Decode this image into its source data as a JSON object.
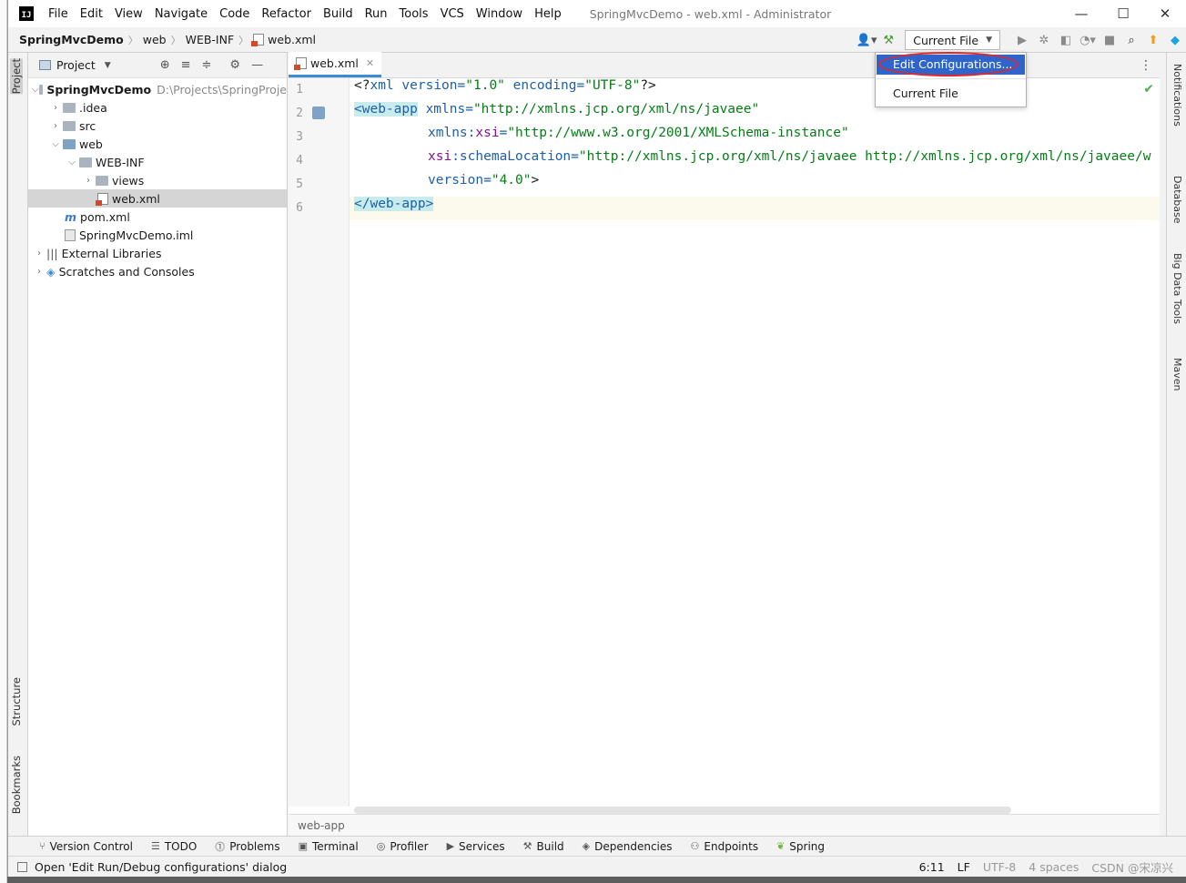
{
  "window": {
    "title": "SpringMvcDemo - web.xml - Administrator",
    "logo": "IJ",
    "controls": {
      "minimize": "—",
      "maximize": "☐",
      "close": "✕"
    }
  },
  "menu": [
    "File",
    "Edit",
    "View",
    "Navigate",
    "Code",
    "Refactor",
    "Build",
    "Run",
    "Tools",
    "VCS",
    "Window",
    "Help"
  ],
  "breadcrumb": [
    "SpringMvcDemo",
    "web",
    "WEB-INF",
    "web.xml"
  ],
  "toolbar": {
    "run_config": "Current File",
    "icons": [
      "user-icon",
      "hammer-icon",
      "run-icon",
      "debug-icon",
      "coverage-icon",
      "profile-icon",
      "stop-icon",
      "search-icon",
      "update-icon",
      "jetbrains-icon"
    ]
  },
  "run_config_menu": {
    "items": [
      "Edit Configurations...",
      "Current File"
    ],
    "highlighted": "Edit Configurations..."
  },
  "project_panel": {
    "title": "Project",
    "tree": [
      {
        "label": "SpringMvcDemo",
        "path": "D:\\Projects\\SpringProje",
        "depth": 0,
        "expanded": true,
        "bold": true
      },
      {
        "label": ".idea",
        "depth": 1,
        "expanded": false
      },
      {
        "label": "src",
        "depth": 1,
        "expanded": false
      },
      {
        "label": "web",
        "depth": 1,
        "expanded": true
      },
      {
        "label": "WEB-INF",
        "depth": 2,
        "expanded": true
      },
      {
        "label": "views",
        "depth": 3,
        "expanded": false
      },
      {
        "label": "web.xml",
        "depth": 3,
        "selected": true
      },
      {
        "label": "pom.xml",
        "depth": 1
      },
      {
        "label": "SpringMvcDemo.iml",
        "depth": 1
      },
      {
        "label": "External Libraries",
        "depth": 0,
        "expanded": false
      },
      {
        "label": "Scratches and Consoles",
        "depth": 0,
        "expanded": false
      }
    ]
  },
  "left_tabs": [
    "Project",
    "Structure",
    "Bookmarks"
  ],
  "right_tabs": [
    "Notifications",
    "Database",
    "Big Data Tools",
    "Maven"
  ],
  "editor": {
    "tab": "web.xml",
    "line_numbers": [
      "1",
      "2",
      "3",
      "4",
      "5",
      "6"
    ],
    "lines": [
      {
        "p1": "<?",
        "p2": "xml",
        "p3": " version=",
        "p4": "\"1.0\"",
        "p5": " encoding=",
        "p6": "\"UTF-8\"",
        "p7": "?>"
      },
      {
        "p1": "<web-app",
        "p2": " xmlns=",
        "p3": "\"http://xmlns.jcp.org/xml/ns/javaee\""
      },
      {
        "p1": "xmlns:",
        "p2": "xsi",
        "p3": "=",
        "p4": "\"http://www.w3.org/2001/XMLSchema-instance\""
      },
      {
        "p1": "xsi",
        "p2": ":schemaLocation=",
        "p3": "\"http://xmlns.jcp.org/xml/ns/javaee http://xmlns.jcp.org/xml/ns/javaee/w"
      },
      {
        "p1": "version=",
        "p2": "\"4.0\"",
        "p3": ">"
      },
      {
        "p1": "</web-app>"
      }
    ],
    "footer_breadcrumb": "web-app"
  },
  "bottom_tools": [
    "Version Control",
    "TODO",
    "Problems",
    "Terminal",
    "Profiler",
    "Services",
    "Build",
    "Dependencies",
    "Endpoints",
    "Spring"
  ],
  "status": {
    "message": "Open 'Edit Run/Debug configurations' dialog",
    "position": "6:11",
    "line_sep": "LF",
    "encoding": "UTF-8",
    "indent": "4 spaces",
    "watermark": "CSDN @宋凉兴"
  },
  "colors": {
    "selection": "#2f65ca",
    "highlight_ring": "#e0282b",
    "tag": "#1e5fa8",
    "string": "#067d17"
  }
}
